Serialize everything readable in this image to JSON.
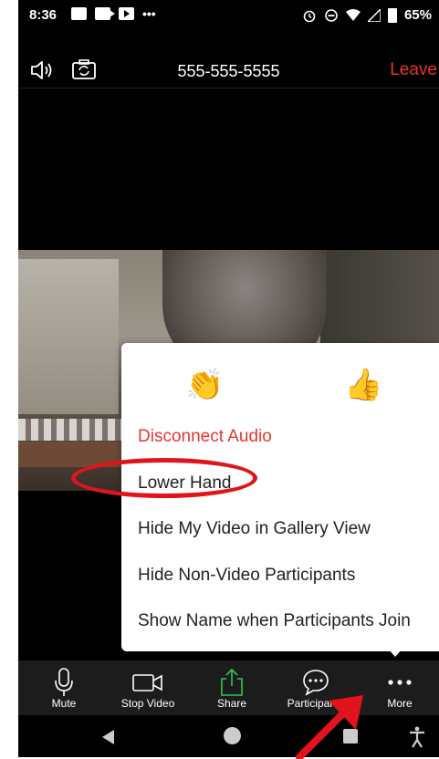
{
  "status": {
    "time": "8:36",
    "battery": "65%"
  },
  "call": {
    "number": "555-555-5555",
    "leave_label": "Leave"
  },
  "reactions": {
    "clap": "👏",
    "thumbs_up": "👍"
  },
  "menu": {
    "items": [
      {
        "label": "Disconnect Audio",
        "style": "danger"
      },
      {
        "label": "Lower Hand"
      },
      {
        "label": "Hide My Video in Gallery View"
      },
      {
        "label": "Hide Non-Video Participants"
      },
      {
        "label": "Show Name when Participants Join"
      }
    ]
  },
  "toolbar": {
    "mute_label": "Mute",
    "stop_video_label": "Stop Video",
    "share_label": "Share",
    "participants_label": "Participants",
    "more_label": "More"
  },
  "colors": {
    "leave": "#e8352e",
    "danger_text": "#e8352e",
    "share_icon": "#35c759",
    "annotation": "#e1141b"
  }
}
